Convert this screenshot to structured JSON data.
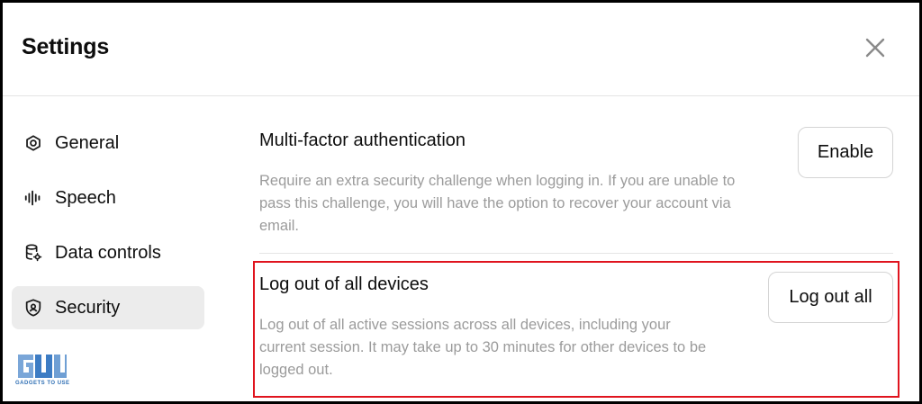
{
  "dialog": {
    "title": "Settings",
    "close_icon": "close-icon"
  },
  "sidebar": {
    "items": [
      {
        "label": "General",
        "icon": "gear-icon",
        "active": false
      },
      {
        "label": "Speech",
        "icon": "waveform-icon",
        "active": false
      },
      {
        "label": "Data controls",
        "icon": "database-gear-icon",
        "active": false
      },
      {
        "label": "Security",
        "icon": "shield-icon",
        "active": true
      }
    ]
  },
  "security": {
    "mfa": {
      "title": "Multi-factor authentication",
      "description": "Require an extra security challenge when logging in. If you are unable to pass this challenge, you will have the option to recover your account via email.",
      "button_label": "Enable"
    },
    "logout_all": {
      "title": "Log out of all devices",
      "description": "Log out of all active sessions across all devices, including your current session. It may take up to 30 minutes for other devices to be logged out.",
      "button_label": "Log out all"
    }
  },
  "watermark": {
    "text": "GADGETS TO USE"
  },
  "colors": {
    "highlight": "#e0141e",
    "active_nav_bg": "#ececec",
    "muted_text": "#9b9b9b",
    "watermark": "#2f6fb4"
  }
}
